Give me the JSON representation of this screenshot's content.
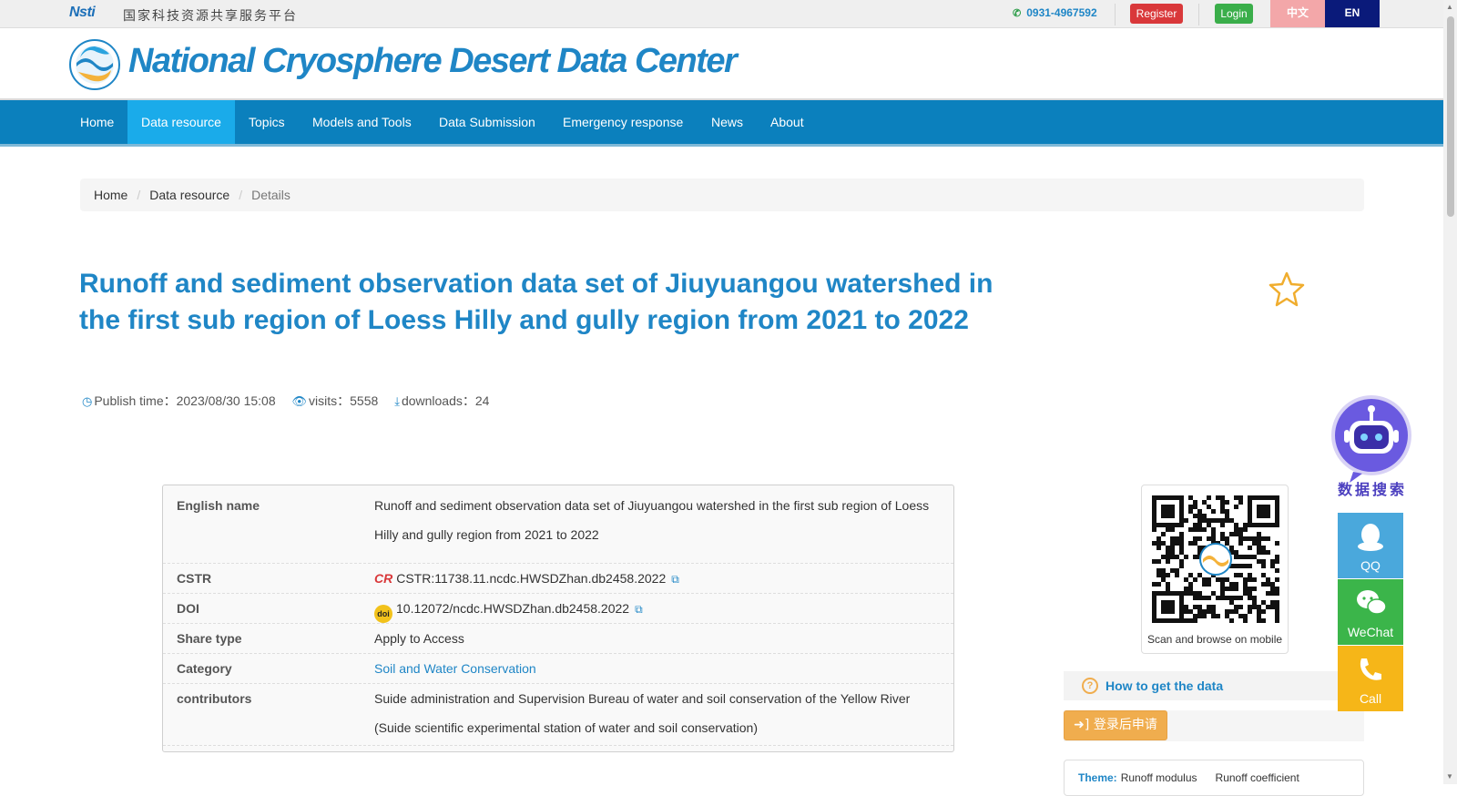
{
  "topbar": {
    "nsti_logo": "Nsti",
    "nsti_text": "国家科技资源共享服务平台",
    "phone": "0931-4967592",
    "register": "Register",
    "login": "Login",
    "lang_zh": "中文",
    "lang_en": "EN"
  },
  "header": {
    "site_title": "National Cryosphere Desert Data Center"
  },
  "nav": {
    "items": [
      "Home",
      "Data resource",
      "Topics",
      "Models and Tools",
      "Data Submission",
      "Emergency response",
      "News",
      "About"
    ],
    "active": "Data resource"
  },
  "breadcrumb": {
    "home": "Home",
    "section": "Data resource",
    "current": "Details"
  },
  "dataset": {
    "title": "Runoff and sediment observation data set of Jiuyuangou watershed in the first sub region of Loess Hilly and gully region from 2021 to 2022",
    "publish_label": "Publish time：",
    "publish_time": "2023/08/30 15:08",
    "visits_label": "visits：",
    "visits": "5558",
    "downloads_label": "downloads：",
    "downloads": "24"
  },
  "info": {
    "english_name_label": "English name",
    "english_name": "Runoff and sediment observation data set of Jiuyuangou watershed in the first sub region of Loess Hilly and gully region from 2021 to 2022",
    "cstr_label": "CSTR",
    "cstr_badge": "CR",
    "cstr": "CSTR:11738.11.ncdc.HWSDZhan.db2458.2022",
    "doi_label": "DOI",
    "doi_badge": "doi",
    "doi": "10.12072/ncdc.HWSDZhan.db2458.2022",
    "share_type_label": "Share type",
    "share_type": "Apply to Access",
    "category_label": "Category",
    "category": "Soil and Water Conservation",
    "contributors_label": "contributors",
    "contributors": "Suide administration and Supervision Bureau of water and soil conservation of the Yellow River (Suide scientific experimental station of water and soil conservation)"
  },
  "sidebar": {
    "robot_caption": "数据搜索",
    "qq": "QQ",
    "wechat": "WeChat",
    "call": "Call",
    "qr_caption": "Scan and browse on mobile",
    "howto": "How to get the data",
    "howto_icon": "?",
    "apply_button": "登录后申请",
    "theme_label": "Theme:",
    "theme_keywords": [
      "Runoff modulus",
      "Runoff coefficient"
    ]
  },
  "colors": {
    "brand_blue": "#1f86c6",
    "nav_bg": "#0b80bd",
    "nav_active": "#1aabea",
    "side_blue": "#4aa8dc",
    "side_green": "#3bb54a",
    "side_orange": "#f6b618"
  }
}
